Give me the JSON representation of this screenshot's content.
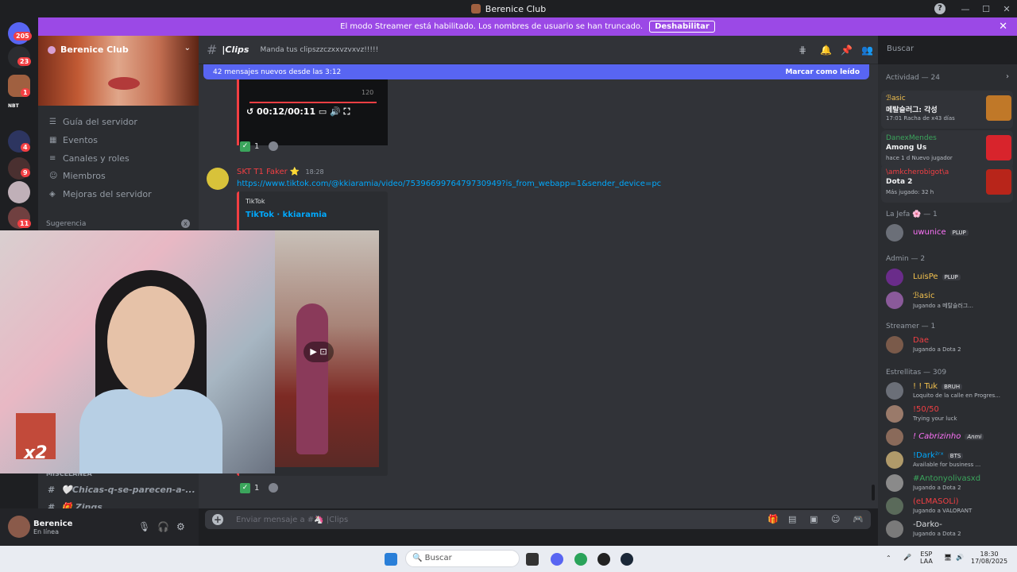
{
  "window": {
    "title": "Berenice Club",
    "help": "?",
    "min": "—",
    "max": "☐",
    "close": "✕"
  },
  "guilds": {
    "dm_badge": "205",
    "notif_badge": "23",
    "badges": [
      "1",
      "4",
      "9",
      "11"
    ],
    "label_nbt": "NBT"
  },
  "banner": {
    "text": "El modo Streamer está habilitado. Los nombres de usuario se han truncado.",
    "button": "Deshabilitar",
    "close": "✕"
  },
  "server": {
    "name": "Berenice Club",
    "chevron": "⌄"
  },
  "nav": [
    {
      "label": "Guía del servidor",
      "icon": "☰"
    },
    {
      "label": "Eventos",
      "icon": "▦"
    },
    {
      "label": "Canales y roles",
      "icon": "≡"
    },
    {
      "label": "Miembros",
      "icon": "☺"
    },
    {
      "label": "Mejoras del servidor",
      "icon": "◈"
    }
  ],
  "suggestion": "Sugerencia",
  "category": "MISCELANEA",
  "channels_list": [
    {
      "hash": "#",
      "name": "🤍Chicas-q-se-parecen-a-..."
    },
    {
      "hash": "#",
      "name": "🎁 Zings"
    }
  ],
  "user": {
    "name": "Berenice",
    "status": "En línea"
  },
  "header": {
    "hash": "#",
    "channel": "|Clips",
    "topic": "Manda tus clipszzczxxvzvxvz!!!!!",
    "search_placeholder": "Buscar"
  },
  "newbar": {
    "text": "42 mensajes nuevos desde las 3:12",
    "action": "Marcar como leído"
  },
  "video": {
    "time": "00:12/00:11",
    "side_count": "120"
  },
  "reactions": [
    {
      "check": "✓",
      "count": "1"
    },
    {
      "check": "✓",
      "count": "1"
    }
  ],
  "message": {
    "author": "SKT T1 Faker",
    "time": "18:28",
    "link": "https://www.tiktok.com/@kkiaramia/video/7539669976479730949?is_from_webapp=1&sender_device=pc",
    "embed_provider": "TikTok",
    "embed_title": "TikTok · kkiaramia",
    "play": "▶ ⊡"
  },
  "overlay": {
    "x2": "x2"
  },
  "composer": {
    "placeholder": "Enviar mensaje a #🦄 |Clips",
    "plus": "+"
  },
  "members": {
    "activity_label": "Actividad — 24",
    "activities": [
      {
        "name": "ℬasic",
        "game": "메탈슬러그: 각성",
        "detail": "17:01  Racha de x43 días",
        "color": "#f2c14e",
        "img": "#c07828"
      },
      {
        "name": "DanexMendes",
        "game": "Among Us",
        "detail": "hace 1 d  Nuevo jugador",
        "color": "#3ba55c",
        "img": "#d8242c"
      },
      {
        "name": "\\amkcherobigot\\a",
        "game": "Dota 2",
        "detail": "Más jugado: 32 h",
        "color": "#f23f43",
        "img": "#b8251a"
      }
    ],
    "groups": [
      {
        "label": "La Jefa 🌸 — 1",
        "members": [
          {
            "name": "uwunice",
            "tag": "PLUP",
            "status": "",
            "color": "#ff73fa"
          }
        ]
      },
      {
        "label": "Admin — 2",
        "members": [
          {
            "name": "LuisPe",
            "tag": "PLUP",
            "status": "",
            "color": "#f2c14e"
          },
          {
            "name": "ℬasic",
            "tag": "",
            "status": "Jugando a 메탈슬러그...",
            "color": "#f2c14e"
          }
        ]
      },
      {
        "label": "Streamer — 1",
        "members": [
          {
            "name": "Dae",
            "tag": "",
            "status": "Jugando a Dota 2",
            "color": "#f23f43"
          }
        ]
      },
      {
        "label": "Estrellitas — 309",
        "members": [
          {
            "name": "! ! Tuk",
            "tag": "BRUH",
            "status": "Loquito de la calle en Progres...",
            "color": "#f2c14e"
          },
          {
            "name": "!50/50",
            "tag": "",
            "status": "Trying your luck",
            "color": "#f23f43"
          },
          {
            "name": "! Cabrizinho",
            "tag": "Anmi",
            "status": "",
            "color": "#ff73fa"
          },
          {
            "name": "!Dark²ʳˣ",
            "tag": "BTS",
            "status": "Available for business ...",
            "color": "#00a8fc"
          },
          {
            "name": "#Antonyolivasxd",
            "tag": "",
            "status": "Jugando a Dota 2",
            "color": "#3ba55c"
          },
          {
            "name": "(eLMASOLi)",
            "tag": "",
            "status": "Jugando a VALORANT",
            "color": "#f23f43"
          },
          {
            "name": "-Darko-",
            "tag": "",
            "status": "Jugando a Dota 2",
            "color": "#dbdee1"
          }
        ]
      }
    ]
  },
  "taskbar": {
    "search": "Buscar",
    "lang": "ESP",
    "lang2": "LAA",
    "time": "18:30",
    "date": "17/08/2025"
  }
}
